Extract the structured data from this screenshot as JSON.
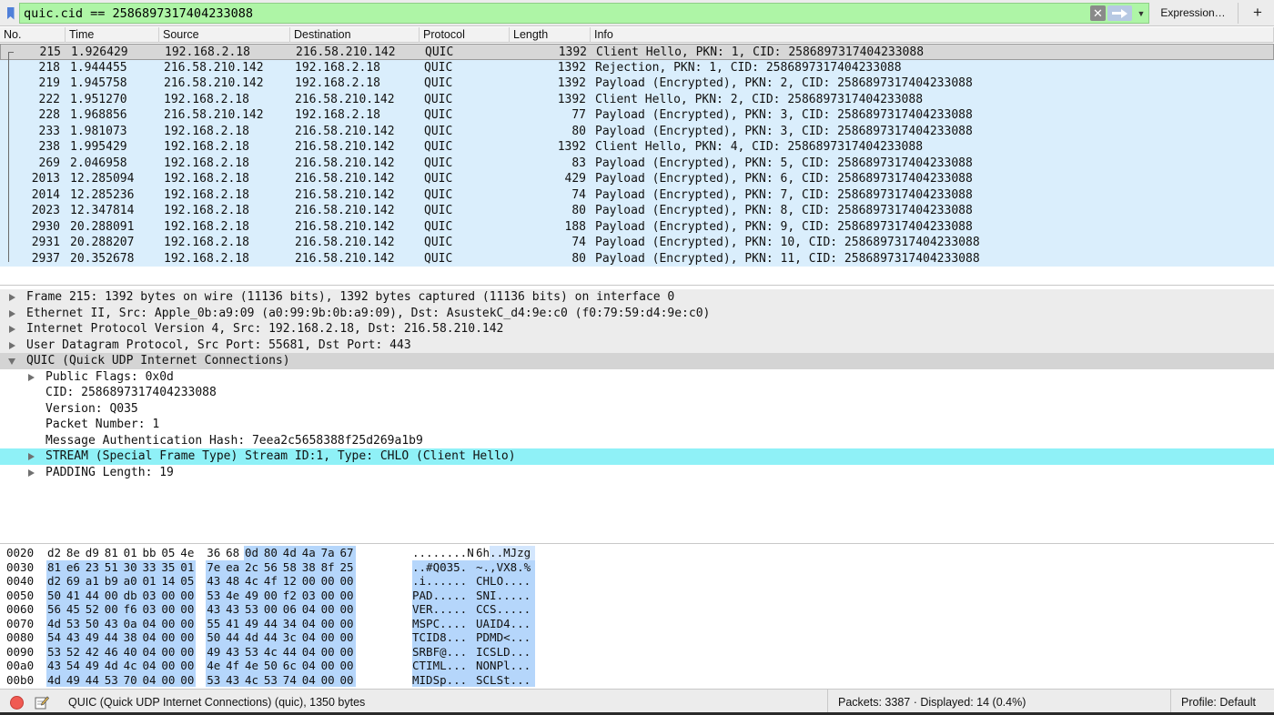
{
  "filter": {
    "value": "quic.cid == 2586897317404233088",
    "clear_icon": "close-icon",
    "apply_icon": "arrow-right-icon",
    "expression_label": "Expression…",
    "add_label": "+"
  },
  "columns": [
    "No.",
    "Time",
    "Source",
    "Destination",
    "Protocol",
    "Length",
    "Info"
  ],
  "packets": [
    {
      "no": "215",
      "time": "1.926429",
      "src": "192.168.2.18",
      "dst": "216.58.210.142",
      "proto": "QUIC",
      "len": "1392",
      "info": "Client Hello, PKN: 1, CID: 2586897317404233088"
    },
    {
      "no": "218",
      "time": "1.944455",
      "src": "216.58.210.142",
      "dst": "192.168.2.18",
      "proto": "QUIC",
      "len": "1392",
      "info": "Rejection, PKN: 1, CID: 2586897317404233088"
    },
    {
      "no": "219",
      "time": "1.945758",
      "src": "216.58.210.142",
      "dst": "192.168.2.18",
      "proto": "QUIC",
      "len": "1392",
      "info": "Payload (Encrypted), PKN: 2, CID: 2586897317404233088"
    },
    {
      "no": "222",
      "time": "1.951270",
      "src": "192.168.2.18",
      "dst": "216.58.210.142",
      "proto": "QUIC",
      "len": "1392",
      "info": "Client Hello, PKN: 2, CID: 2586897317404233088"
    },
    {
      "no": "228",
      "time": "1.968856",
      "src": "216.58.210.142",
      "dst": "192.168.2.18",
      "proto": "QUIC",
      "len": "77",
      "info": "Payload (Encrypted), PKN: 3, CID: 2586897317404233088"
    },
    {
      "no": "233",
      "time": "1.981073",
      "src": "192.168.2.18",
      "dst": "216.58.210.142",
      "proto": "QUIC",
      "len": "80",
      "info": "Payload (Encrypted), PKN: 3, CID: 2586897317404233088"
    },
    {
      "no": "238",
      "time": "1.995429",
      "src": "192.168.2.18",
      "dst": "216.58.210.142",
      "proto": "QUIC",
      "len": "1392",
      "info": "Client Hello, PKN: 4, CID: 2586897317404233088"
    },
    {
      "no": "269",
      "time": "2.046958",
      "src": "192.168.2.18",
      "dst": "216.58.210.142",
      "proto": "QUIC",
      "len": "83",
      "info": "Payload (Encrypted), PKN: 5, CID: 2586897317404233088"
    },
    {
      "no": "2013",
      "time": "12.285094",
      "src": "192.168.2.18",
      "dst": "216.58.210.142",
      "proto": "QUIC",
      "len": "429",
      "info": "Payload (Encrypted), PKN: 6, CID: 2586897317404233088"
    },
    {
      "no": "2014",
      "time": "12.285236",
      "src": "192.168.2.18",
      "dst": "216.58.210.142",
      "proto": "QUIC",
      "len": "74",
      "info": "Payload (Encrypted), PKN: 7, CID: 2586897317404233088"
    },
    {
      "no": "2023",
      "time": "12.347814",
      "src": "192.168.2.18",
      "dst": "216.58.210.142",
      "proto": "QUIC",
      "len": "80",
      "info": "Payload (Encrypted), PKN: 8, CID: 2586897317404233088"
    },
    {
      "no": "2930",
      "time": "20.288091",
      "src": "192.168.2.18",
      "dst": "216.58.210.142",
      "proto": "QUIC",
      "len": "188",
      "info": "Payload (Encrypted), PKN: 9, CID: 2586897317404233088"
    },
    {
      "no": "2931",
      "time": "20.288207",
      "src": "192.168.2.18",
      "dst": "216.58.210.142",
      "proto": "QUIC",
      "len": "74",
      "info": "Payload (Encrypted), PKN: 10, CID: 2586897317404233088"
    },
    {
      "no": "2937",
      "time": "20.352678",
      "src": "192.168.2.18",
      "dst": "216.58.210.142",
      "proto": "QUIC",
      "len": "80",
      "info": "Payload (Encrypted), PKN: 11, CID: 2586897317404233088"
    }
  ],
  "details": [
    {
      "text": "Frame 215: 1392 bytes on wire (11136 bits), 1392 bytes captured (11136 bits) on interface 0",
      "level": 0,
      "toggle": "closed",
      "style": "gray"
    },
    {
      "text": "Ethernet II, Src: Apple_0b:a9:09 (a0:99:9b:0b:a9:09), Dst: AsustekC_d4:9e:c0 (f0:79:59:d4:9e:c0)",
      "level": 0,
      "toggle": "closed",
      "style": "gray"
    },
    {
      "text": "Internet Protocol Version 4, Src: 192.168.2.18, Dst: 216.58.210.142",
      "level": 0,
      "toggle": "closed",
      "style": "gray"
    },
    {
      "text": "User Datagram Protocol, Src Port: 55681, Dst Port: 443",
      "level": 0,
      "toggle": "closed",
      "style": "gray"
    },
    {
      "text": "QUIC (Quick UDP Internet Connections)",
      "level": 0,
      "toggle": "open",
      "style": "open"
    },
    {
      "text": "Public Flags: 0x0d",
      "level": 1,
      "toggle": "closed",
      "style": "plain"
    },
    {
      "text": "CID: 2586897317404233088",
      "level": 1,
      "toggle": "none",
      "style": "plain"
    },
    {
      "text": "Version: Q035",
      "level": 1,
      "toggle": "none",
      "style": "plain"
    },
    {
      "text": "Packet Number: 1",
      "level": 1,
      "toggle": "none",
      "style": "plain"
    },
    {
      "text": "Message Authentication Hash: 7eea2c5658388f25d269a1b9",
      "level": 1,
      "toggle": "none",
      "style": "plain"
    },
    {
      "text": "STREAM (Special Frame Type) Stream ID:1, Type: CHLO (Client Hello)",
      "level": 1,
      "toggle": "closed",
      "style": "hl"
    },
    {
      "text": "PADDING Length: 19",
      "level": 1,
      "toggle": "closed",
      "style": "plain"
    }
  ],
  "bytes": [
    {
      "offset": "0020",
      "hex": [
        "d2",
        "8e",
        "d9",
        "81",
        "01",
        "bb",
        "05",
        "4e",
        "36",
        "68",
        "0d",
        "80",
        "4d",
        "4a",
        "7a",
        "67"
      ],
      "ascii": [
        "........N",
        "6h..MJzg"
      ],
      "hl_from": 10,
      "ascii_hl_from": 11
    },
    {
      "offset": "0030",
      "hex": [
        "81",
        "e6",
        "23",
        "51",
        "30",
        "33",
        "35",
        "01",
        "7e",
        "ea",
        "2c",
        "56",
        "58",
        "38",
        "8f",
        "25"
      ],
      "ascii": [
        "..#Q035.",
        "~.,VX8.%"
      ],
      "hl_from": 0,
      "ascii_hl_from": 0
    },
    {
      "offset": "0040",
      "hex": [
        "d2",
        "69",
        "a1",
        "b9",
        "a0",
        "01",
        "14",
        "05",
        "43",
        "48",
        "4c",
        "4f",
        "12",
        "00",
        "00",
        "00"
      ],
      "ascii": [
        ".i......",
        "CHLO...."
      ],
      "hl_from": 0,
      "ascii_hl_from": 0
    },
    {
      "offset": "0050",
      "hex": [
        "50",
        "41",
        "44",
        "00",
        "db",
        "03",
        "00",
        "00",
        "53",
        "4e",
        "49",
        "00",
        "f2",
        "03",
        "00",
        "00"
      ],
      "ascii": [
        "PAD.....",
        "SNI....."
      ],
      "hl_from": 0,
      "ascii_hl_from": 0
    },
    {
      "offset": "0060",
      "hex": [
        "56",
        "45",
        "52",
        "00",
        "f6",
        "03",
        "00",
        "00",
        "43",
        "43",
        "53",
        "00",
        "06",
        "04",
        "00",
        "00"
      ],
      "ascii": [
        "VER.....",
        "CCS....."
      ],
      "hl_from": 0,
      "ascii_hl_from": 0
    },
    {
      "offset": "0070",
      "hex": [
        "4d",
        "53",
        "50",
        "43",
        "0a",
        "04",
        "00",
        "00",
        "55",
        "41",
        "49",
        "44",
        "34",
        "04",
        "00",
        "00"
      ],
      "ascii": [
        "MSPC....",
        "UAID4..."
      ],
      "hl_from": 0,
      "ascii_hl_from": 0
    },
    {
      "offset": "0080",
      "hex": [
        "54",
        "43",
        "49",
        "44",
        "38",
        "04",
        "00",
        "00",
        "50",
        "44",
        "4d",
        "44",
        "3c",
        "04",
        "00",
        "00"
      ],
      "ascii": [
        "TCID8...",
        "PDMD<..."
      ],
      "hl_from": 0,
      "ascii_hl_from": 0
    },
    {
      "offset": "0090",
      "hex": [
        "53",
        "52",
        "42",
        "46",
        "40",
        "04",
        "00",
        "00",
        "49",
        "43",
        "53",
        "4c",
        "44",
        "04",
        "00",
        "00"
      ],
      "ascii": [
        "SRBF@...",
        "ICSLD..."
      ],
      "hl_from": 0,
      "ascii_hl_from": 0
    },
    {
      "offset": "00a0",
      "hex": [
        "43",
        "54",
        "49",
        "4d",
        "4c",
        "04",
        "00",
        "00",
        "4e",
        "4f",
        "4e",
        "50",
        "6c",
        "04",
        "00",
        "00"
      ],
      "ascii": [
        "CTIML...",
        "NONPl..."
      ],
      "hl_from": 0,
      "ascii_hl_from": 0
    },
    {
      "offset": "00b0",
      "hex": [
        "4d",
        "49",
        "44",
        "53",
        "70",
        "04",
        "00",
        "00",
        "53",
        "43",
        "4c",
        "53",
        "74",
        "04",
        "00",
        "00"
      ],
      "ascii": [
        "MIDSp...",
        "SCLSt..."
      ],
      "hl_from": 0,
      "ascii_hl_from": 0
    }
  ],
  "status": {
    "indicator_icon": "capture-status-icon",
    "edit_icon": "edit-comment-icon",
    "text": "QUIC (Quick UDP Internet Connections) (quic), 1350 bytes",
    "packets": "Packets: 3387 · Displayed: 14 (0.4%)",
    "profile": "Profile: Default"
  },
  "colors": {
    "filter_valid": "#aef5a6",
    "row_bg": "#daeefc",
    "selected_row": "#d7d7d7",
    "highlight_field": "#8ff1f7",
    "byte_highlight": "#b5d6fb"
  }
}
